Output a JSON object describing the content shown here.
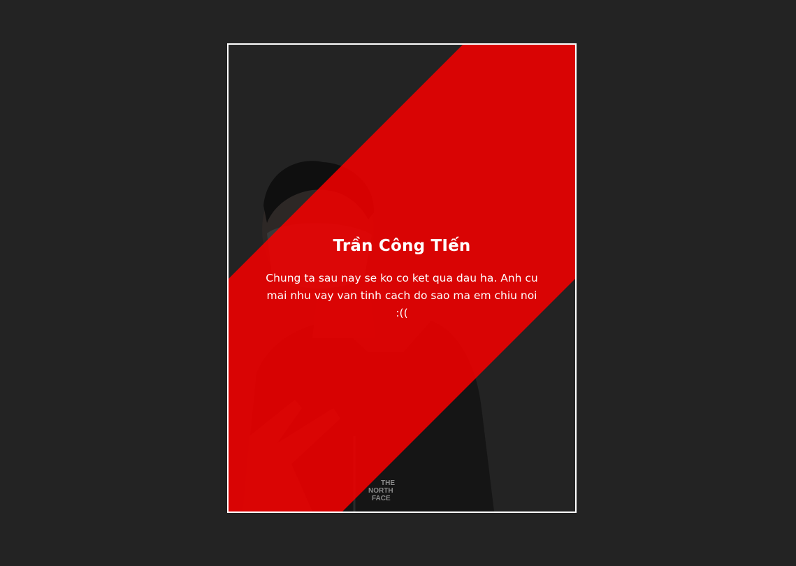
{
  "card": {
    "title": "Trần Công TIến",
    "description": "Chung ta sau nay se ko co ket qua dau ha. Anh cu mai nhu vay van tinh cach do sao ma em chiu noi :(("
  },
  "colors": {
    "background": "#232323",
    "accent": "#d60808",
    "border": "#ffffff",
    "text": "#ffffff"
  },
  "photo": {
    "subject": "person-with-mask-peace-sign",
    "shirt_logo": "THE NORTH FACE"
  }
}
